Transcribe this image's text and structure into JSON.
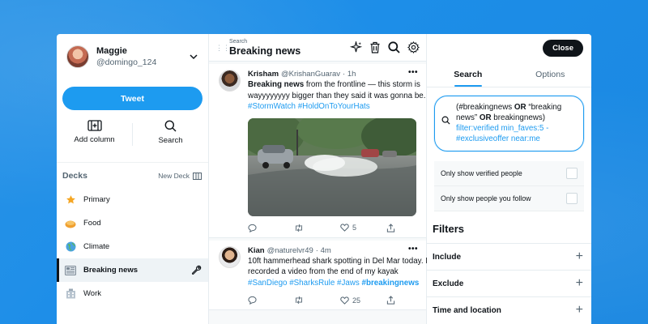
{
  "account": {
    "name": "Maggie",
    "handle": "@domingo_124"
  },
  "sidebar": {
    "tweet_label": "Tweet",
    "actions": [
      {
        "label": "Add column",
        "icon": "add-column-icon"
      },
      {
        "label": "Search",
        "icon": "search-icon"
      }
    ],
    "decks_title": "Decks",
    "new_deck_label": "New Deck",
    "decks": [
      {
        "label": "Primary",
        "icon": "star-icon"
      },
      {
        "label": "Food",
        "icon": "food-icon"
      },
      {
        "label": "Climate",
        "icon": "globe-icon"
      },
      {
        "label": "Breaking news",
        "icon": "newspaper-icon",
        "active": true
      },
      {
        "label": "Work",
        "icon": "building-icon"
      }
    ]
  },
  "column": {
    "subtitle": "Search",
    "title": "Breaking news",
    "tweets": [
      {
        "name": "Krisham",
        "handle": "@KrishanGuarav",
        "time": "· 1h",
        "text_bold": "Breaking news",
        "text": " from the frontline — this storm is wayyyyyyyy bigger than they said it was gonna be. ",
        "tags": "#StormWatch #HoldOnToYourHats",
        "likes": "5"
      },
      {
        "name": "Kian",
        "handle": "@naturelvr49",
        "time": "· 4m",
        "text": "10ft hammerhead shark spotting in Del Mar today. I recorded a video from the end of my kayak ",
        "tags": "#SanDiego #SharksRule #Jaws",
        "tag_bold": "#breakingnews",
        "likes": "25"
      }
    ]
  },
  "panel": {
    "close_label": "Close",
    "tabs": [
      "Search",
      "Options"
    ],
    "query": {
      "p1": "(#breakingnews ",
      "op1": "OR",
      "p2": " “breaking news” ",
      "op2": "OR",
      "p3": " breakingnews)",
      "blue": "filter:verified min_faves:5 -#exclusiveoffer near:me"
    },
    "options": [
      "Only show verified people",
      "Only show people you follow"
    ],
    "filters_title": "Filters",
    "filters": [
      "Include",
      "Exclude",
      "Time and location"
    ]
  }
}
